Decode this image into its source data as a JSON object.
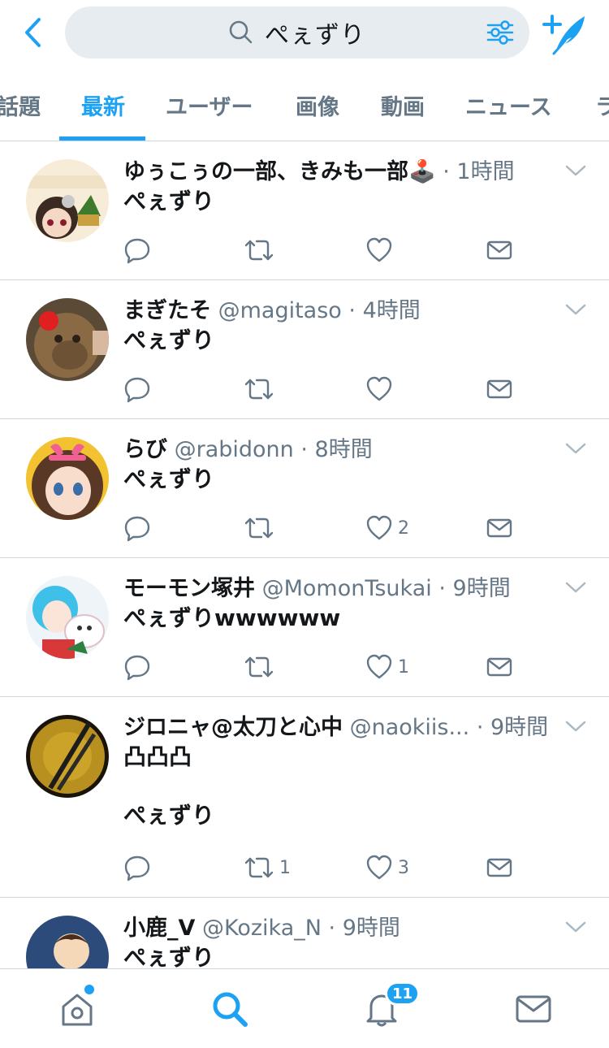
{
  "header": {
    "search_query": "ぺぇずり",
    "icons": {
      "back": "chevron-left-icon",
      "search": "search-icon",
      "filter": "filter-sliders-icon",
      "compose": "compose-feather-icon"
    }
  },
  "colors": {
    "accent": "#1da1f2",
    "muted": "#657786",
    "text": "#14171a",
    "divider": "#ccd6dd",
    "search_bg": "#e6ecf0"
  },
  "tabs": [
    {
      "label": "話題",
      "active": false
    },
    {
      "label": "最新",
      "active": true
    },
    {
      "label": "ユーザー",
      "active": false
    },
    {
      "label": "画像",
      "active": false
    },
    {
      "label": "動画",
      "active": false
    },
    {
      "label": "ニュース",
      "active": false
    },
    {
      "label": "ラ",
      "active": false
    }
  ],
  "tweets": [
    {
      "name": "ゆぅこぅの一部、きみも一部🕹️",
      "handle": "",
      "time": "1時間",
      "text": "ぺぇずり",
      "reply_count": "",
      "retweet_count": "",
      "like_count": ""
    },
    {
      "name": "まぎたそ",
      "handle": "@magitaso",
      "time": "4時間",
      "text": "ぺぇずり",
      "reply_count": "",
      "retweet_count": "",
      "like_count": ""
    },
    {
      "name": "らび",
      "handle": "@rabidonn",
      "time": "8時間",
      "text": "ぺぇずり",
      "reply_count": "",
      "retweet_count": "",
      "like_count": "2"
    },
    {
      "name": "モーモン塚井",
      "handle": "@MomonTsukai",
      "time": "9時間",
      "text": "ぺぇずりwwwwww",
      "reply_count": "",
      "retweet_count": "",
      "like_count": "1"
    },
    {
      "name": "ジロニャ@太刀と心中",
      "handle": "@naokiis...",
      "time": "9時間",
      "text": "凸凸凸\n\nぺぇずり",
      "reply_count": "",
      "retweet_count": "1",
      "like_count": "3"
    },
    {
      "name": "小鹿_V",
      "handle": "@Kozika_N",
      "time": "9時間",
      "text": "ぺぇずり",
      "reply_count": "",
      "retweet_count": "",
      "like_count": ""
    }
  ],
  "bottom_nav": {
    "items": [
      "home-icon",
      "search-icon",
      "notifications-bell-icon",
      "messages-envelope-icon"
    ],
    "notification_badge": "11"
  }
}
